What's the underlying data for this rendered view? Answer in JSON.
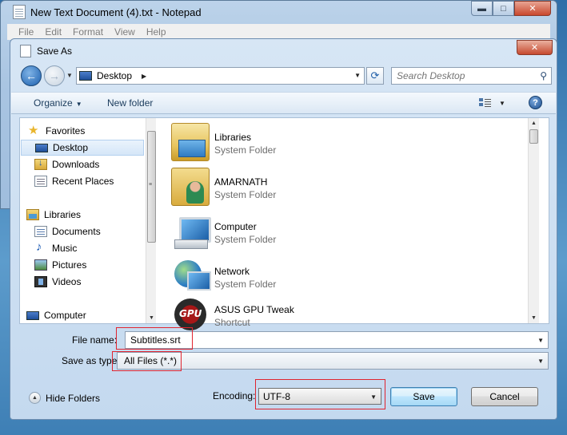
{
  "notepad": {
    "title": "New Text Document (4).txt - Notepad",
    "menu": [
      "File",
      "Edit",
      "Format",
      "View",
      "Help"
    ],
    "caption_buttons": {
      "minimize": "▬",
      "maximize": "□",
      "close": "✕"
    }
  },
  "dialog": {
    "title": "Save As",
    "close_glyph": "✕",
    "address": {
      "location": "Desktop"
    },
    "search": {
      "placeholder": "Search Desktop"
    },
    "toolbar": {
      "organize": "Organize",
      "new_folder": "New folder"
    },
    "nav": {
      "items": [
        {
          "label": "Favorites",
          "icon": "star-icon"
        },
        {
          "label": "Desktop",
          "icon": "desktop-icon",
          "selected": true
        },
        {
          "label": "Downloads",
          "icon": "downloads-icon"
        },
        {
          "label": "Recent Places",
          "icon": "recent-places-icon"
        },
        {
          "label": "Libraries",
          "icon": "libraries-icon"
        },
        {
          "label": "Documents",
          "icon": "documents-icon"
        },
        {
          "label": "Music",
          "icon": "music-icon"
        },
        {
          "label": "Pictures",
          "icon": "pictures-icon"
        },
        {
          "label": "Videos",
          "icon": "videos-icon"
        },
        {
          "label": "Computer",
          "icon": "computer-icon"
        }
      ]
    },
    "files": [
      {
        "name": "Libraries",
        "type": "System Folder",
        "icon": "libraries-folder-icon"
      },
      {
        "name": "AMARNATH",
        "type": "System Folder",
        "icon": "user-folder-icon"
      },
      {
        "name": "Computer",
        "type": "System Folder",
        "icon": "computer-icon"
      },
      {
        "name": "Network",
        "type": "System Folder",
        "icon": "network-icon"
      },
      {
        "name": "ASUS GPU Tweak",
        "type": "Shortcut",
        "icon": "asus-gpu-tweak-icon"
      }
    ],
    "form": {
      "file_name_label": "File name:",
      "file_name_value": "Subtitles.srt",
      "save_as_type_label": "Save as type:",
      "save_as_type_value": "All Files  (*.*)",
      "hide_folders": "Hide Folders",
      "encoding_label": "Encoding:",
      "encoding_value": "UTF-8",
      "save_button": "Save",
      "cancel_button": "Cancel"
    },
    "highlight_color": "#e0242f"
  }
}
